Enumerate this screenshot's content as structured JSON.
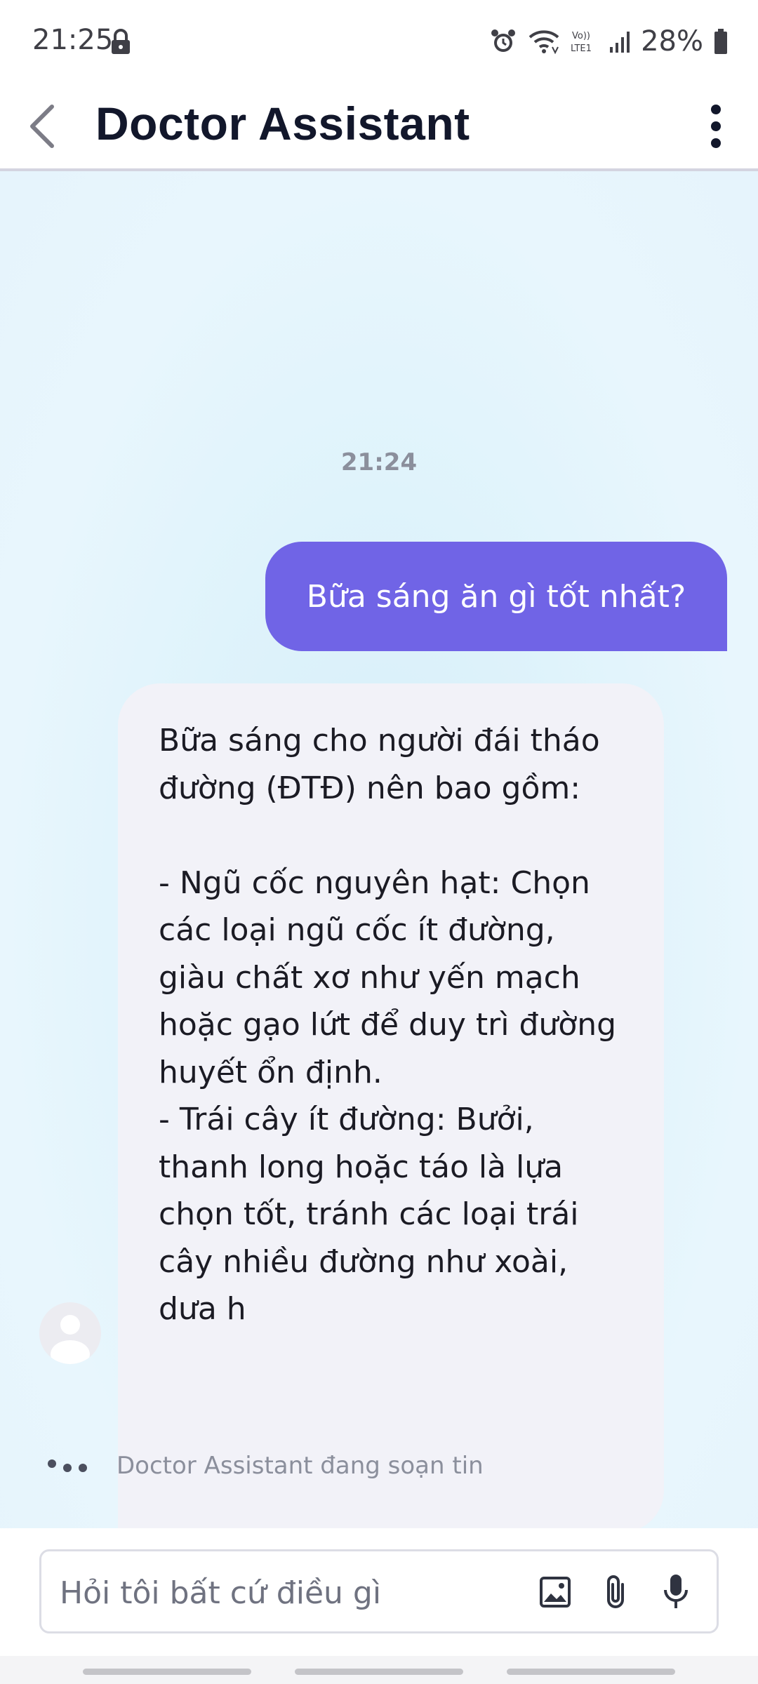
{
  "status_bar": {
    "time": "21:25",
    "battery_percent": "28%",
    "network_label": "Vo)) LTE1",
    "icons": [
      "lock-icon",
      "alarm-icon",
      "wifi-icon",
      "signal-icon",
      "battery-icon"
    ]
  },
  "header": {
    "title": "Doctor Assistant",
    "back_icon": "chevron-left-icon",
    "menu_icon": "more-vertical-icon"
  },
  "chat": {
    "timestamp": "21:24",
    "messages": [
      {
        "sender": "user",
        "text": "Bữa sáng ăn gì tốt nhất?"
      },
      {
        "sender": "assistant",
        "text": "Bữa sáng cho người đái tháo đường (ĐTĐ) nên bao gồm:\n\n- Ngũ cốc nguyên hạt: Chọn các loại ngũ cốc ít đường, giàu chất xơ như yến mạch hoặc gạo lứt để duy trì đường huyết ổn định.\n- Trái cây ít đường: Bưởi, thanh long hoặc táo là lựa chọn tốt, tránh các loại trái cây nhiều đường như xoài, dưa h"
      }
    ],
    "typing_indicator": "Doctor Assistant đang soạn tin"
  },
  "input": {
    "placeholder": "Hỏi tôi bất cứ điều gì",
    "value": "",
    "actions": [
      "image-icon",
      "paperclip-icon",
      "microphone-icon"
    ]
  },
  "colors": {
    "user_bubble": "#7064e6",
    "assistant_bubble": "#f2f2f8",
    "chat_background": "#e0f3fb",
    "title": "#12172b"
  }
}
